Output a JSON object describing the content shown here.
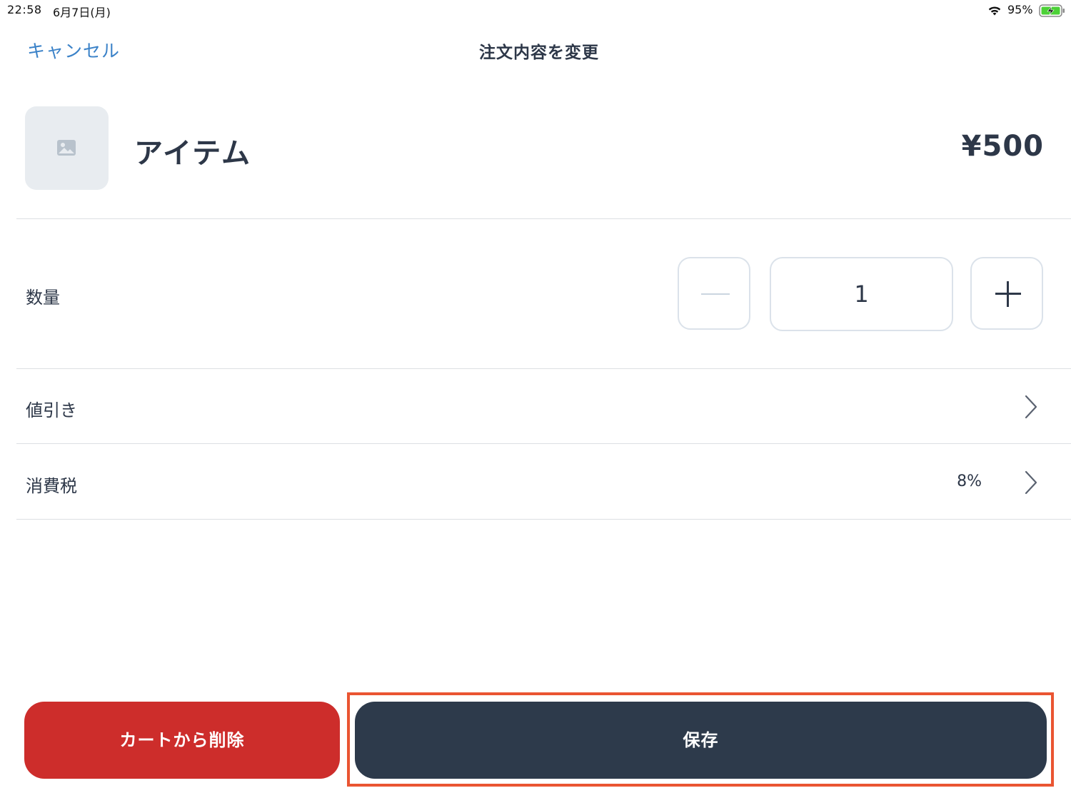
{
  "status_bar": {
    "time": "22:58",
    "date": "6月7日(月)",
    "battery_percent": "95%",
    "wifi_icon": "wifi-icon",
    "battery_icon": "battery-charging-icon"
  },
  "nav": {
    "cancel_label": "キャンセル",
    "title": "注文内容を変更"
  },
  "item": {
    "name": "アイテム",
    "price": "¥500",
    "thumbnail_icon": "image-placeholder-icon"
  },
  "quantity": {
    "label": "数量",
    "value": "1",
    "decrement_icon": "minus-icon",
    "increment_icon": "plus-icon"
  },
  "discount": {
    "label": "値引き",
    "chevron_icon": "chevron-right-icon"
  },
  "tax": {
    "label": "消費税",
    "value": "8%",
    "chevron_icon": "chevron-right-icon"
  },
  "actions": {
    "remove_label": "カートから削除",
    "save_label": "保存"
  },
  "colors": {
    "link_blue": "#3b82c8",
    "remove_red": "#cd2d2b",
    "save_dark": "#2d3a4b",
    "highlight_orange": "#ea5532",
    "text_dark": "#2d3748",
    "border_light": "#dbe2ea"
  }
}
